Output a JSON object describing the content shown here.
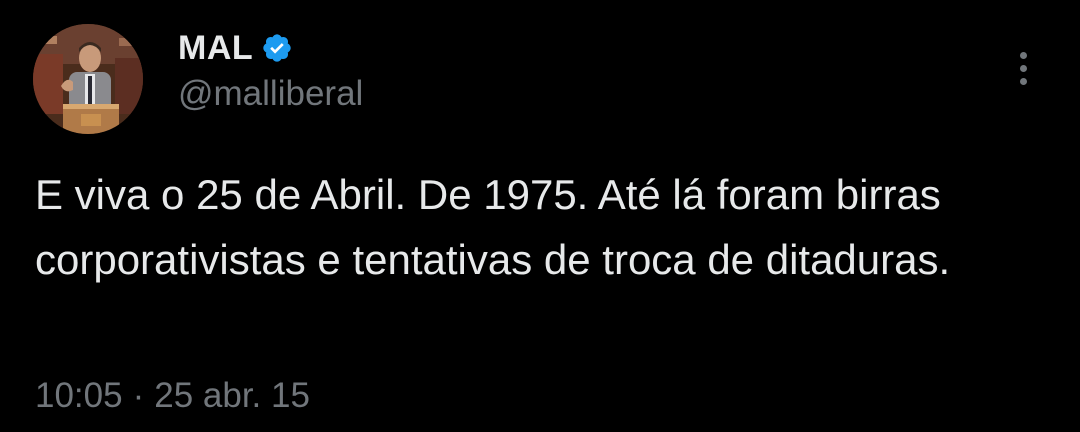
{
  "tweet": {
    "author": {
      "display_name": "MAL",
      "handle": "@malliberal",
      "verified": true,
      "avatar_icon": "avatar-photo-speaker-at-podium"
    },
    "text": "E viva o 25 de Abril. De 1975. Até lá foram birras corporativistas e tentativas de troca de ditaduras.",
    "timestamp": {
      "time": "10:05",
      "separator": "·",
      "date": "25 abr. 15"
    },
    "more_icon": "more-vertical-icon"
  },
  "colors": {
    "background": "#000000",
    "primary_text": "#e7e9ea",
    "secondary_text": "#71767b",
    "verified_badge": "#1d9bf0"
  }
}
